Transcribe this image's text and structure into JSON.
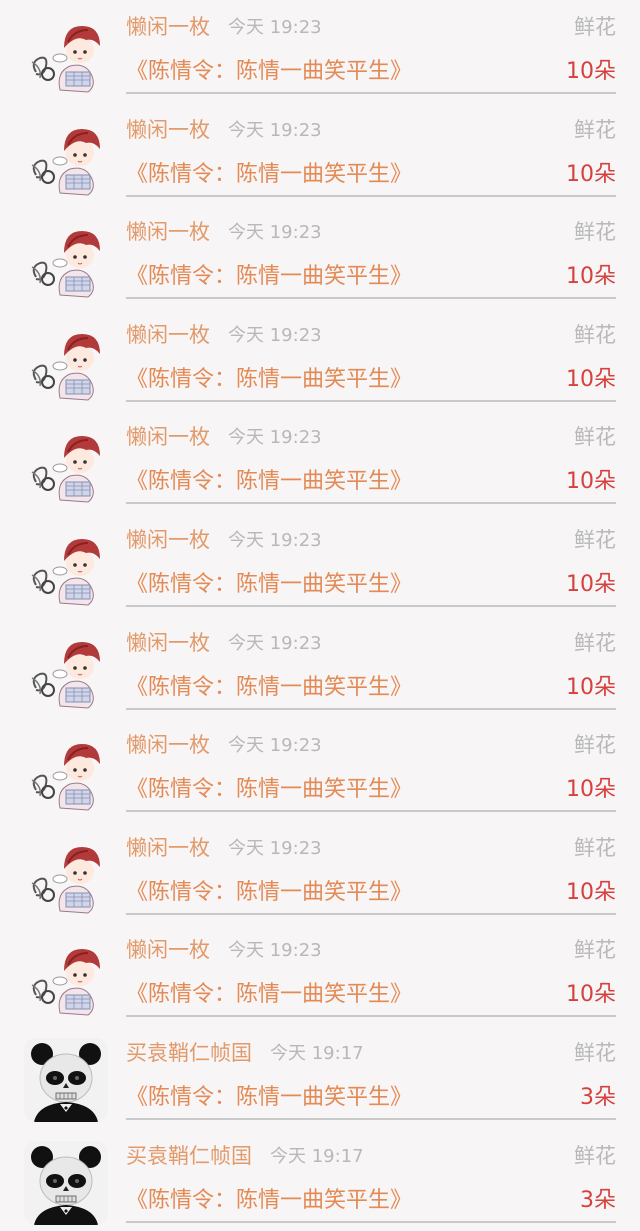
{
  "feed": {
    "items": [
      {
        "user": "懒闲一枚",
        "time": "今天 19:23",
        "gift": "鲜花",
        "book": "《陈情令：陈情一曲笑平生》",
        "count": "10朵",
        "avatar": "chibi-avatar-icon"
      },
      {
        "user": "懒闲一枚",
        "time": "今天 19:23",
        "gift": "鲜花",
        "book": "《陈情令：陈情一曲笑平生》",
        "count": "10朵",
        "avatar": "chibi-avatar-icon"
      },
      {
        "user": "懒闲一枚",
        "time": "今天 19:23",
        "gift": "鲜花",
        "book": "《陈情令：陈情一曲笑平生》",
        "count": "10朵",
        "avatar": "chibi-avatar-icon"
      },
      {
        "user": "懒闲一枚",
        "time": "今天 19:23",
        "gift": "鲜花",
        "book": "《陈情令：陈情一曲笑平生》",
        "count": "10朵",
        "avatar": "chibi-avatar-icon"
      },
      {
        "user": "懒闲一枚",
        "time": "今天 19:23",
        "gift": "鲜花",
        "book": "《陈情令：陈情一曲笑平生》",
        "count": "10朵",
        "avatar": "chibi-avatar-icon"
      },
      {
        "user": "懒闲一枚",
        "time": "今天 19:23",
        "gift": "鲜花",
        "book": "《陈情令：陈情一曲笑平生》",
        "count": "10朵",
        "avatar": "chibi-avatar-icon"
      },
      {
        "user": "懒闲一枚",
        "time": "今天 19:23",
        "gift": "鲜花",
        "book": "《陈情令：陈情一曲笑平生》",
        "count": "10朵",
        "avatar": "chibi-avatar-icon"
      },
      {
        "user": "懒闲一枚",
        "time": "今天 19:23",
        "gift": "鲜花",
        "book": "《陈情令：陈情一曲笑平生》",
        "count": "10朵",
        "avatar": "chibi-avatar-icon"
      },
      {
        "user": "懒闲一枚",
        "time": "今天 19:23",
        "gift": "鲜花",
        "book": "《陈情令：陈情一曲笑平生》",
        "count": "10朵",
        "avatar": "chibi-avatar-icon"
      },
      {
        "user": "懒闲一枚",
        "time": "今天 19:23",
        "gift": "鲜花",
        "book": "《陈情令：陈情一曲笑平生》",
        "count": "10朵",
        "avatar": "chibi-avatar-icon"
      },
      {
        "user": "买袁鞘仁帧国",
        "time": "今天 19:17",
        "gift": "鲜花",
        "book": "《陈情令：陈情一曲笑平生》",
        "count": "3朵",
        "avatar": "panda-skull-avatar-icon"
      },
      {
        "user": "买袁鞘仁帧国",
        "time": "今天 19:17",
        "gift": "鲜花",
        "book": "《陈情令：陈情一曲笑平生》",
        "count": "3朵",
        "avatar": "panda-skull-avatar-icon"
      }
    ]
  },
  "colors": {
    "username": "#e39a6b",
    "book_title": "#e38a55",
    "count": "#d6403d",
    "muted": "#b8b8b8",
    "background": "#f7f5f5"
  }
}
